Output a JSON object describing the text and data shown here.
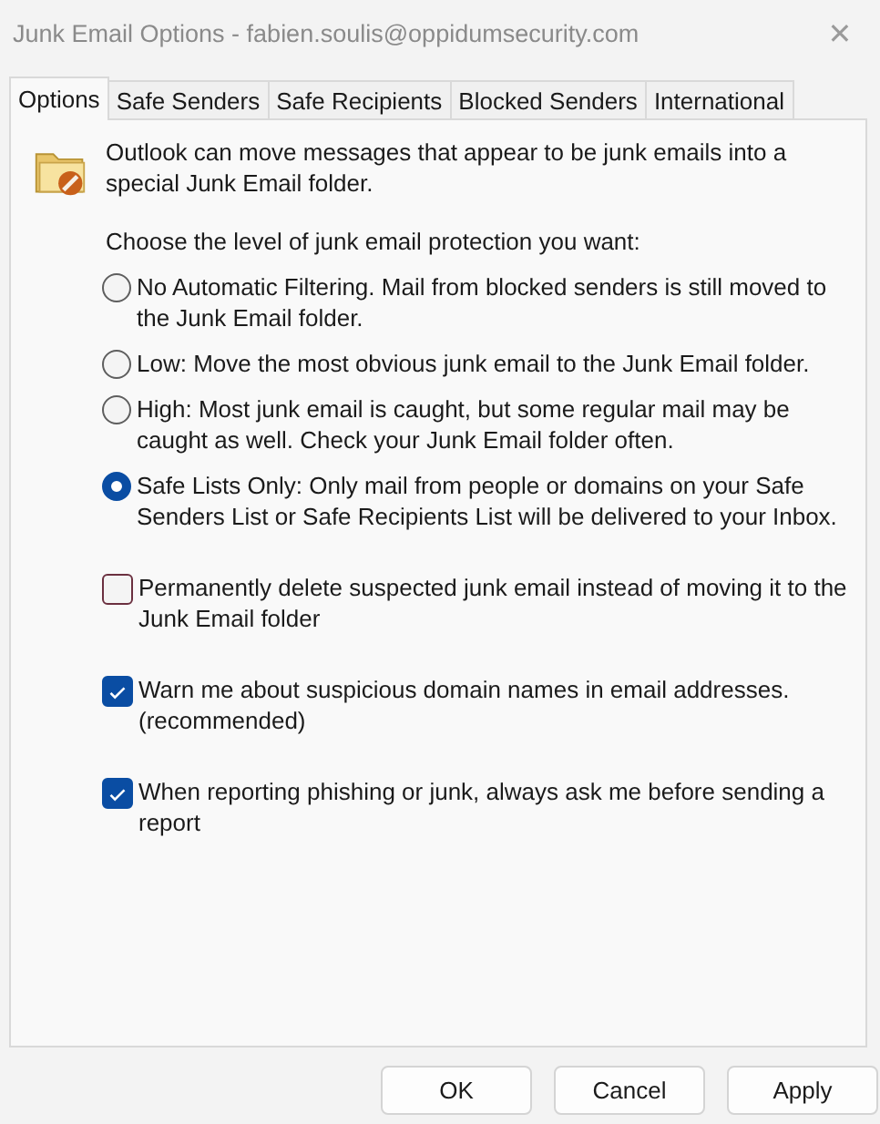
{
  "window": {
    "title": "Junk Email Options - fabien.soulis@oppidumsecurity.com",
    "close": "✕"
  },
  "tabs": [
    {
      "label": "Options",
      "selected": true
    },
    {
      "label": "Safe Senders",
      "selected": false
    },
    {
      "label": "Safe Recipients",
      "selected": false
    },
    {
      "label": "Blocked Senders",
      "selected": false
    },
    {
      "label": "International",
      "selected": false
    }
  ],
  "intro": "Outlook can move messages that appear to be junk emails into a special Junk Email folder.",
  "prompt": "Choose the level of junk email protection you want:",
  "levels": [
    {
      "label": "No Automatic Filtering. Mail from blocked senders is still moved to the Junk Email folder.",
      "selected": false
    },
    {
      "label": "Low: Move the most obvious junk email to the Junk Email folder.",
      "selected": false
    },
    {
      "label": "High: Most junk email is caught, but some regular mail may be caught as well. Check your Junk Email folder often.",
      "selected": false
    },
    {
      "label": "Safe Lists Only: Only mail from people or domains on your Safe Senders List or Safe Recipients List will be delivered to your Inbox.",
      "selected": true
    }
  ],
  "options": [
    {
      "label": "Permanently delete suspected junk email instead of moving it to the Junk Email folder",
      "checked": false
    },
    {
      "label": "Warn me about suspicious domain names in email addresses. (recommended)",
      "checked": true
    },
    {
      "label": "When reporting phishing or junk, always ask me before sending a report",
      "checked": true
    }
  ],
  "buttons": [
    "OK",
    "Cancel",
    "Apply"
  ]
}
